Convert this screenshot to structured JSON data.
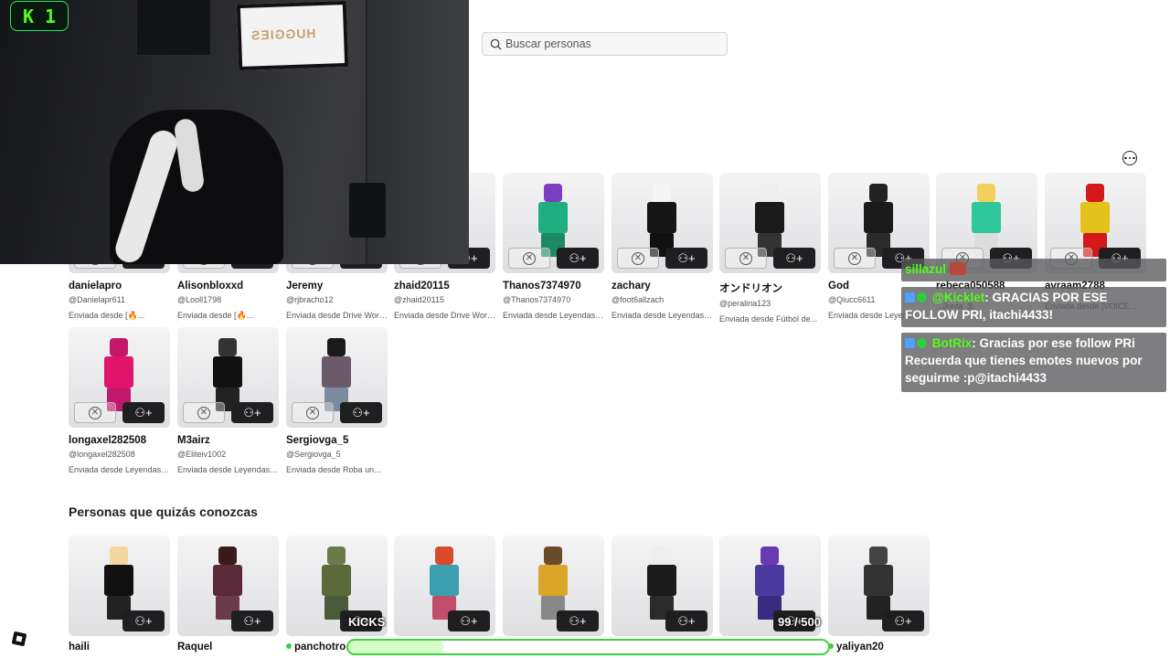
{
  "search": {
    "placeholder": "Buscar personas"
  },
  "stream": {
    "kick_number": "1",
    "tv_text": "HUGGIES",
    "goal_label": "KICKS",
    "goal_count": "99 / 500",
    "goal_progress": 0.198,
    "brand_color": "#53fc18"
  },
  "requests": [
    {
      "name": "danielapro",
      "handle": "@Danielapr611",
      "sent": "Enviada desde [🔥..."
    },
    {
      "name": "Alisonbloxxd",
      "handle": "@Looll1798",
      "sent": "Enviada desde [🔥..."
    },
    {
      "name": "Jeremy",
      "handle": "@rjbracho12",
      "sent": "Enviada desde Drive World..."
    },
    {
      "name": "zhaid20115",
      "handle": "@zhaid20115",
      "sent": "Enviada desde Drive World..."
    },
    {
      "name": "Thanos7374970",
      "handle": "@Thanos7374970",
      "sent": "Enviada desde Leyendas de..."
    },
    {
      "name": "zachary",
      "handle": "@foot6allzach",
      "sent": "Enviada desde Leyendas de..."
    },
    {
      "name": "オンドリオン",
      "handle": "@peralina123",
      "sent": "Enviada desde Fútbol de..."
    },
    {
      "name": "God",
      "handle": "@Qiucc6611",
      "sent": "Enviada desde Leyen..."
    },
    {
      "name": "rebeca050588",
      "handle": "",
      "sent": "...Junta 🏝"
    },
    {
      "name": "avraam2788",
      "handle": "",
      "sent": "Enviada desde [VOICE..."
    },
    {
      "name": "longaxel282508",
      "handle": "@longaxel282508",
      "sent": "Enviada desde Leyendas de..."
    },
    {
      "name": "M3airz",
      "handle": "@Eliteiv1002",
      "sent": "Enviada desde Leyendas de..."
    },
    {
      "name": "Sergiovga_5",
      "handle": "@Sergiovga_5",
      "sent": "Enviada desde Roba un..."
    }
  ],
  "suggestions": {
    "title": "Personas que quizás conozcas",
    "people": [
      {
        "name": "haili"
      },
      {
        "name": "Raquel"
      },
      {
        "name": "panchotro"
      },
      {
        "name": ""
      },
      {
        "name": ""
      },
      {
        "name": ""
      },
      {
        "name": ""
      },
      {
        "name": "yaliyan20"
      }
    ]
  },
  "chat": [
    {
      "user": "sillazul",
      "text": ""
    },
    {
      "user": "@Kicklet",
      "text": ": GRACIAS POR ESE FOLLOW PRI, itachi4433!"
    },
    {
      "user": "BotRix",
      "text": ": Gracias por ese follow PRi Recuerda que tienes emotes nuevos por seguirme :p@itachi4433"
    }
  ]
}
